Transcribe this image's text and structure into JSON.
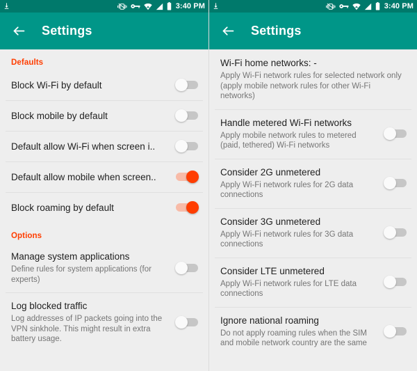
{
  "theme": {
    "appbar_color": "#009688",
    "statusbar_color": "#00796B",
    "accent_color": "#FF3D00",
    "background": "#eeeeee",
    "title_text_color": "#212121",
    "subtitle_text_color": "#757575"
  },
  "statusbar": {
    "time": "3:40 PM",
    "icons_left": [
      "download-icon"
    ],
    "icons_right": [
      "vibrate-mute-icon",
      "vpn-key-icon",
      "wifi-icon",
      "signal-icon",
      "battery-icon"
    ]
  },
  "appbar": {
    "title": "Settings",
    "back_icon": "arrow-back-icon"
  },
  "left_panel": {
    "sections": [
      {
        "header": "Defaults",
        "rows": [
          {
            "title": "Block Wi-Fi by default",
            "subtitle": "",
            "toggle": "off"
          },
          {
            "title": "Block mobile by default",
            "subtitle": "",
            "toggle": "off"
          },
          {
            "title": "Default allow Wi-Fi when screen i..",
            "subtitle": "",
            "toggle": "off"
          },
          {
            "title": "Default allow mobile when screen..",
            "subtitle": "",
            "toggle": "on"
          },
          {
            "title": "Block roaming by default",
            "subtitle": "",
            "toggle": "on"
          }
        ]
      },
      {
        "header": "Options",
        "rows": [
          {
            "title": "Manage system applications",
            "subtitle": "Define rules for system applications (for experts)",
            "toggle": "off"
          },
          {
            "title": "Log blocked traffic",
            "subtitle": "Log addresses of IP packets going into the VPN sinkhole. This might result in extra battery usage.",
            "toggle": "off"
          }
        ]
      }
    ]
  },
  "right_panel": {
    "sections": [
      {
        "header": "",
        "rows": [
          {
            "title": "Wi-Fi home networks: -",
            "subtitle": "Apply Wi-Fi network rules for selected network only (apply mobile network rules for other Wi-Fi networks)",
            "toggle": "none"
          },
          {
            "title": "Handle metered Wi-Fi networks",
            "subtitle": "Apply mobile network rules to metered (paid, tethered) Wi-Fi networks",
            "toggle": "off"
          },
          {
            "title": "Consider 2G unmetered",
            "subtitle": "Apply Wi-Fi network rules for 2G data connections",
            "toggle": "off"
          },
          {
            "title": "Consider 3G unmetered",
            "subtitle": "Apply Wi-Fi network rules for 3G data connections",
            "toggle": "off"
          },
          {
            "title": "Consider LTE unmetered",
            "subtitle": "Apply Wi-Fi network rules for LTE data connections",
            "toggle": "off"
          },
          {
            "title": "Ignore national roaming",
            "subtitle": "Do not apply roaming rules when the SIM and mobile network country are the same",
            "toggle": "off"
          }
        ]
      }
    ]
  }
}
